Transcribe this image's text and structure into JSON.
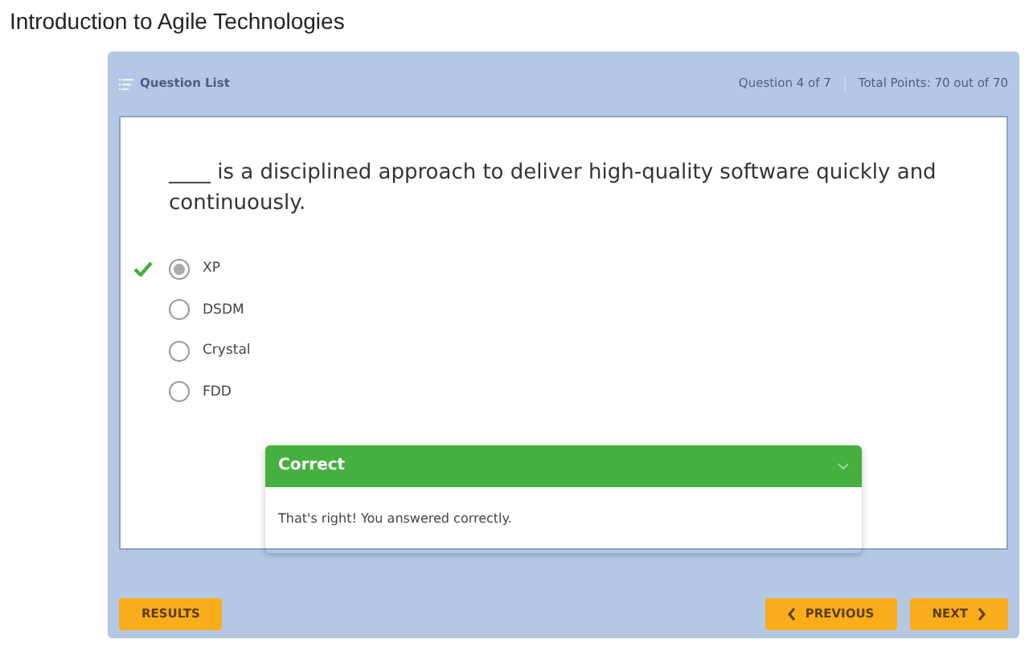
{
  "page_title": "Introduction to Agile Technologies",
  "header": {
    "question_list": "Question List",
    "progress": "Question 4 of 7",
    "points": "Total Points: 70 out of 70"
  },
  "question": "____ is a disciplined approach to deliver high-quality software quickly and continuously.",
  "options": [
    {
      "label": "XP",
      "selected": true,
      "correct": true
    },
    {
      "label": "DSDM",
      "selected": false,
      "correct": false
    },
    {
      "label": "Crystal",
      "selected": false,
      "correct": false
    },
    {
      "label": "FDD",
      "selected": false,
      "correct": false
    }
  ],
  "feedback": {
    "title": "Correct",
    "message": "That's right! You answered correctly.",
    "expanded": true
  },
  "buttons": {
    "results": "RESULTS",
    "previous": "PREVIOUS",
    "next": "NEXT"
  }
}
